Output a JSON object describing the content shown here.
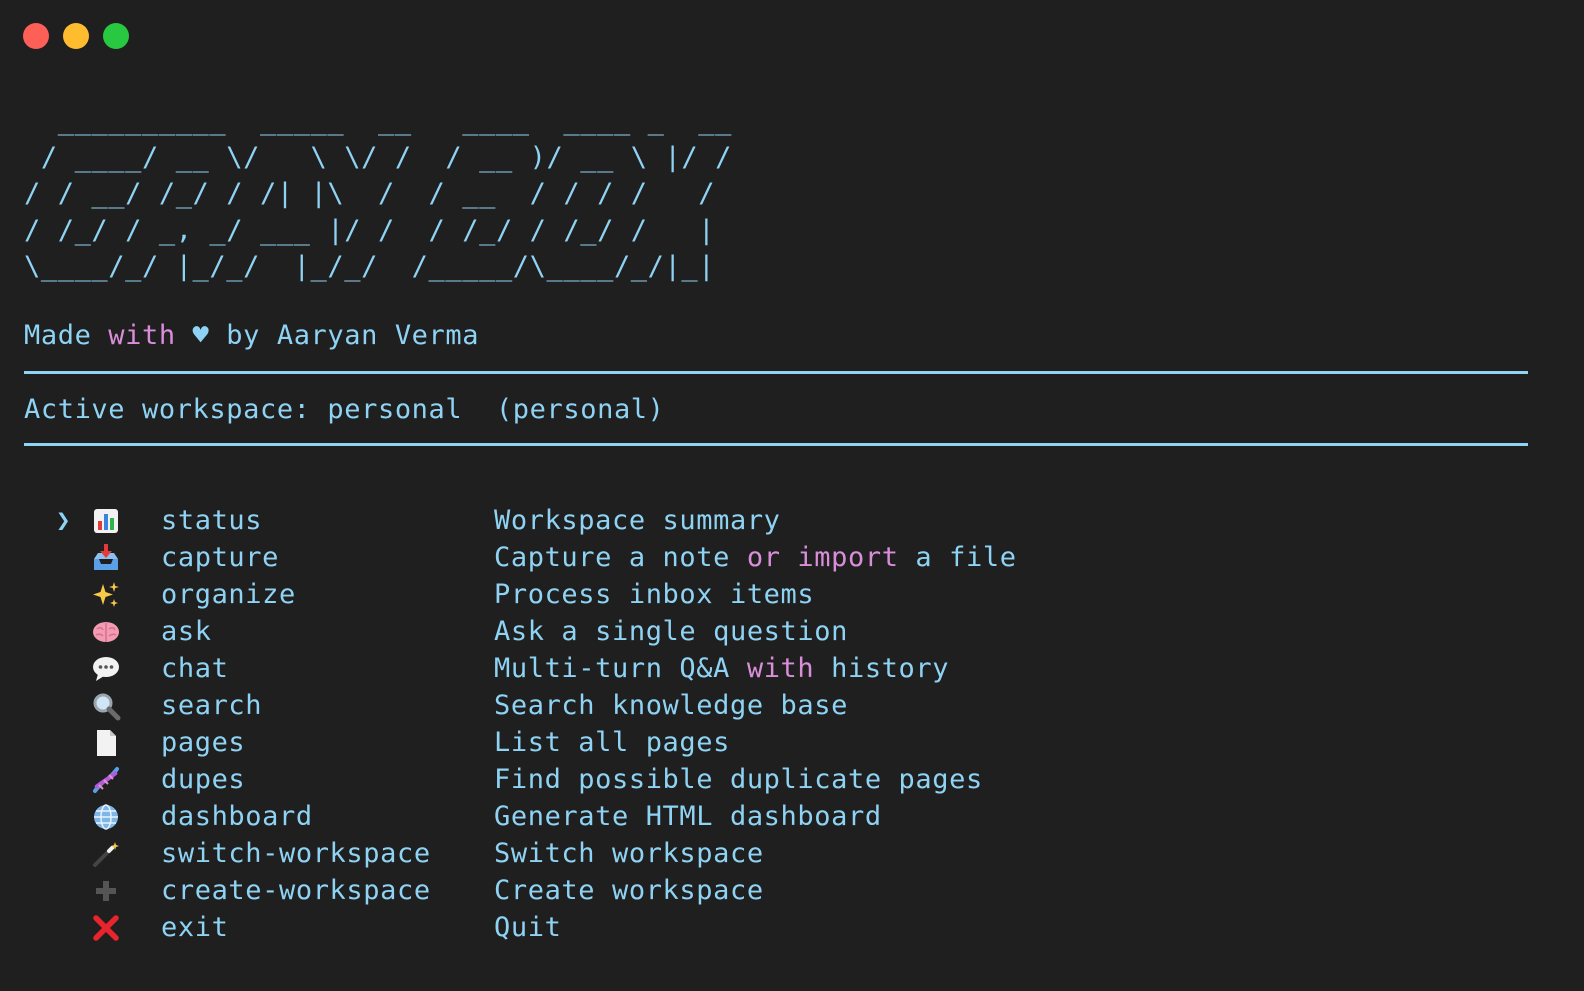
{
  "window": {
    "controls": [
      "close",
      "minimize",
      "zoom"
    ]
  },
  "banner": {
    "ascii_art": "  __________  _____  __   ____  ____ _  __\n / ____/ __ \\/   \\ \\/ /  / __ )/ __ \\ |/ /\n/ / __/ /_/ / /| |\\  /  / __  / / / /   / \n/ /_/ / _, _/ ___ |/ /  / /_/ / /_/ /   |  \n\\____/_/ |_/_/  |_/_/  /_____/\\____/_/|_|  "
  },
  "credit": {
    "part1": "Made ",
    "keyword": "with",
    "part2": " ♥ by Aaryan Verma"
  },
  "workspace": {
    "text": "Active workspace: personal  (personal)"
  },
  "menu": {
    "cursor": "❯",
    "items": [
      {
        "icon": "bar-chart-icon",
        "command": "status",
        "description": [
          "Workspace summary"
        ]
      },
      {
        "icon": "inbox-tray-icon",
        "command": "capture",
        "description": [
          "Capture a note ",
          "or",
          " ",
          "import",
          " a file"
        ]
      },
      {
        "icon": "sparkles-icon",
        "command": "organize",
        "description": [
          "Process inbox items"
        ]
      },
      {
        "icon": "brain-icon",
        "command": "ask",
        "description": [
          "Ask a single question"
        ]
      },
      {
        "icon": "speech-bubble-icon",
        "command": "chat",
        "description": [
          "Multi-turn Q&A ",
          "with",
          " history"
        ]
      },
      {
        "icon": "magnifier-icon",
        "command": "search",
        "description": [
          "Search knowledge base"
        ]
      },
      {
        "icon": "page-icon",
        "command": "pages",
        "description": [
          "List all pages"
        ]
      },
      {
        "icon": "dna-icon",
        "command": "dupes",
        "description": [
          "Find possible duplicate pages"
        ]
      },
      {
        "icon": "globe-icon",
        "command": "dashboard",
        "description": [
          "Generate HTML dashboard"
        ]
      },
      {
        "icon": "magic-wand-icon",
        "command": "switch-workspace",
        "description": [
          "Switch workspace"
        ]
      },
      {
        "icon": "plus-icon",
        "command": "create-workspace",
        "description": [
          "Create workspace"
        ]
      },
      {
        "icon": "cross-mark-icon",
        "command": "exit",
        "description": [
          "Quit"
        ]
      }
    ]
  },
  "colors": {
    "background": "#1f1f1f",
    "text": "#8fd3f4",
    "keyword": "#d98ed9",
    "close": "#fe5f57",
    "minimize": "#febc2e",
    "zoom": "#28c840"
  }
}
